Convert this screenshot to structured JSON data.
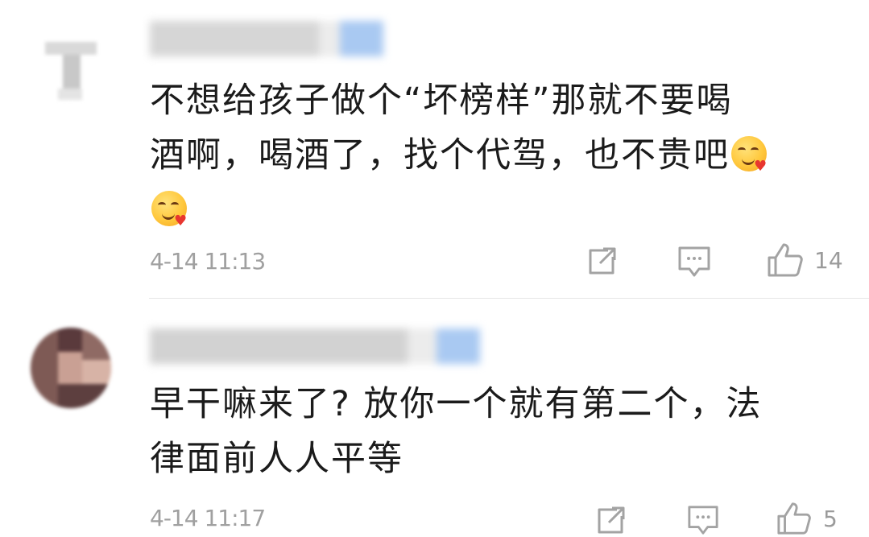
{
  "comments": [
    {
      "text_line1": "不想给孩子做个“坏榜样”那就不要喝",
      "text_line2": "酒啊，喝酒了，找个代驾，也不贵吧",
      "timestamp": "4-14 11:13",
      "like_count": "14",
      "emoji_count": 2
    },
    {
      "text_line1": "早干嘛来了? 放你一个就有第二个，法",
      "text_line2": "律面前人人平等",
      "timestamp": "4-14 11:17",
      "like_count": "5"
    }
  ],
  "icons": {
    "share": "share-icon",
    "comment": "comment-icon",
    "like": "thumbs-up-icon"
  },
  "colors": {
    "text": "#1b1b1b",
    "meta": "#a0a0a0",
    "name_blur_gray": "#cfcfcf",
    "name_blur_blue": "#a9c9f2"
  }
}
